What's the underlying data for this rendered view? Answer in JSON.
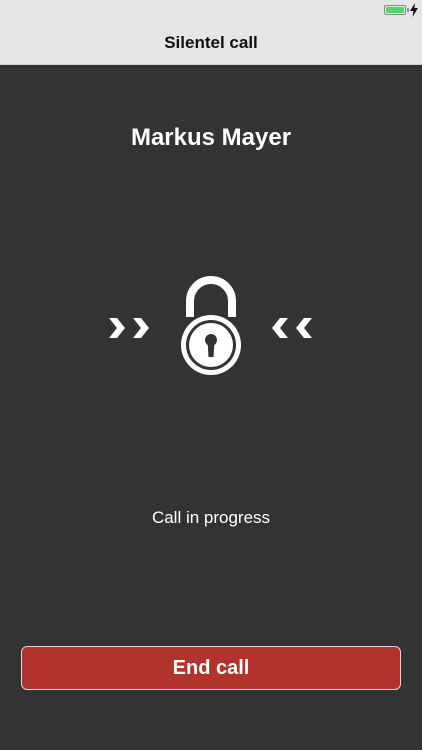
{
  "status_bar": {
    "battery_level": 1.0,
    "battery_color": "#4cd964",
    "charging_icon": "lightning-bolt-icon"
  },
  "nav": {
    "title": "Silentel call"
  },
  "call": {
    "caller_name": "Markus Mayer",
    "status": "Call in progress",
    "lock_icon": "padlock-icon",
    "left_indicator_icon": "double-chevron-right-icon",
    "right_indicator_icon": "double-chevron-left-icon"
  },
  "actions": {
    "end_call_label": "End call",
    "end_call_color": "#b2332b"
  }
}
